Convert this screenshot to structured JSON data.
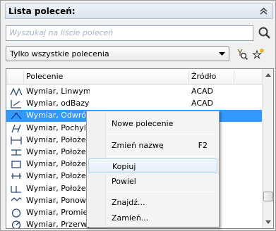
{
  "panel": {
    "title": "Lista poleceń:",
    "search_placeholder": "Wyszukaj na liście poleceń",
    "filter_value": "Tylko wszystkie polecenia"
  },
  "table": {
    "col_command": "Polecenie",
    "col_source": "Źródło",
    "rows": [
      {
        "name": "Wymiar, Linwymskr",
        "source": "ACAD"
      },
      {
        "name": "Wymiar, odBazy",
        "source": "ACAD"
      },
      {
        "name": "Wymiar, Odwróć strzałkę",
        "source": "ACAD"
      },
      {
        "name": "Wymiar, Pochyl",
        "source": ""
      },
      {
        "name": "Wymiar, Położenie",
        "source": ""
      },
      {
        "name": "Wymiar, Położenie",
        "source": ""
      },
      {
        "name": "Wymiar, Położenie",
        "source": ""
      },
      {
        "name": "Wymiar, Położenie",
        "source": ""
      },
      {
        "name": "Wymiar, Położenie",
        "source": ""
      },
      {
        "name": "Wymiar, Ponowne",
        "source": ""
      },
      {
        "name": "Wymiar, Promień",
        "source": ""
      },
      {
        "name": "Wymiar, Przerwym",
        "source": ""
      }
    ],
    "selected_index": 2
  },
  "context_menu": {
    "new_command": "Nowe polecenie",
    "rename": "Zmień nazwę",
    "rename_shortcut": "F2",
    "copy": "Kopiuj",
    "duplicate": "Powiel",
    "find": "Znajdź...",
    "replace": "Zamień..."
  }
}
